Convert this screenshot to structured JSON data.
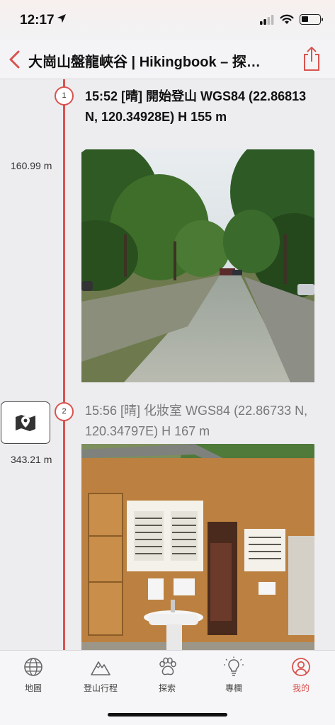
{
  "status_bar": {
    "time": "12:17",
    "icons": [
      "location-arrow-icon",
      "cellular-signal-icon",
      "wifi-icon",
      "battery-icon"
    ]
  },
  "nav": {
    "title": "大崗山盤龍峽谷 | Hikingbook – 探…",
    "back_icon": "chevron-left-icon",
    "share_icon": "share-icon"
  },
  "timeline": {
    "color": "#d9534f",
    "entries": [
      {
        "number": "1",
        "distance": "160.99 m",
        "title": "15:52 [晴] 開始登山 WGS84 (22.86813 N, 120.34928E) H 155 m",
        "photo": "forest-road-photo"
      },
      {
        "number": "2",
        "distance": "343.21 m",
        "title": "15:56 [晴] 化妝室 WGS84 (22.86733 N, 120.34797E) H 167 m",
        "photo": "restroom-building-photo",
        "map_icon": "map-pin-icon"
      }
    ]
  },
  "tabs": [
    {
      "label": "地圖",
      "icon": "globe-icon",
      "active": false
    },
    {
      "label": "登山行程",
      "icon": "mountain-icon",
      "active": false
    },
    {
      "label": "探索",
      "icon": "paw-icon",
      "active": false
    },
    {
      "label": "專欄",
      "icon": "lightbulb-icon",
      "active": false
    },
    {
      "label": "我的",
      "icon": "user-circle-icon",
      "active": true
    }
  ],
  "colors": {
    "accent": "#d9534f",
    "background": "#ededf0"
  }
}
